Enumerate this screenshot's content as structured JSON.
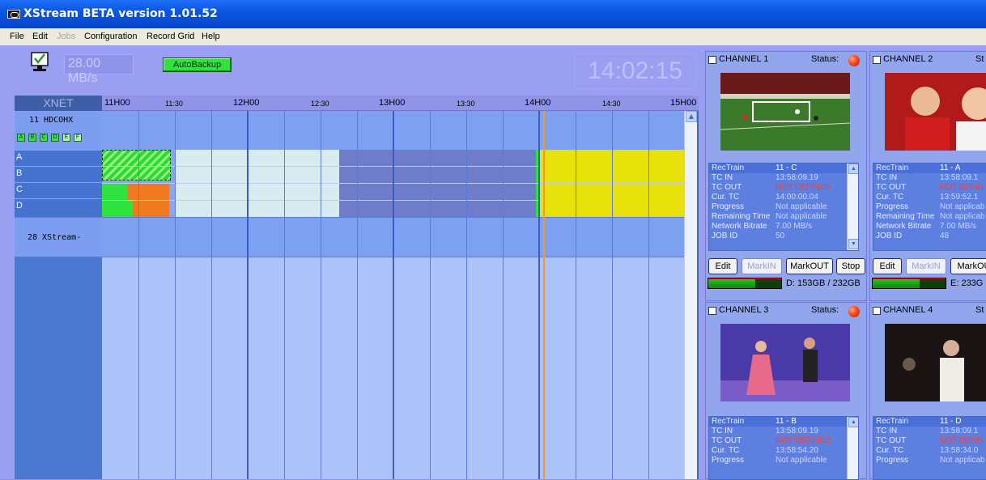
{
  "window": {
    "title": "XStream  BETA version 1.01.52"
  },
  "menu": {
    "file": "File",
    "edit": "Edit",
    "jobs": "Jobs",
    "configuration": "Configuration",
    "record_grid": "Record Grid",
    "help": "Help"
  },
  "toolbar": {
    "bitrate": "28.00 MB/s",
    "autobackup": "AutoBackup",
    "clock": "14:02:15"
  },
  "timeline": {
    "header_left": "XNET",
    "ticks": [
      "11H00",
      "11:30",
      "12H00",
      "12:30",
      "13H00",
      "13:30",
      "14H00",
      "14:30",
      "15H00"
    ],
    "device_name": "11 HDCOHX",
    "channel_boxes": [
      "A",
      "B",
      "C",
      "D",
      "E",
      "F"
    ],
    "rows": [
      "A",
      "B",
      "C",
      "D"
    ],
    "xstream_label": "28 XStream-"
  },
  "channels": [
    {
      "name": "CHANNEL 1",
      "status_label": "Status:",
      "info": {
        "rectrain_label": "RecTrain",
        "rectrain": "11 - C",
        "tc_in_label": "TC IN",
        "tc_in": "13:58:09.19",
        "tc_out_label": "TC OUT",
        "tc_out": "NOT DEFINED",
        "cur_tc_label": "Cur. TC",
        "cur_tc": "14:00:00.04",
        "progress_label": "Progress",
        "progress": "Not applicable",
        "remaining_label": "Remaining Time",
        "remaining": "Not applicable",
        "bitrate_label": "Network Bitrate",
        "bitrate": "7.00 MB/s",
        "job_label": "JOB ID",
        "job": "50"
      },
      "buttons": {
        "edit": "Edit",
        "markin": "MarkIN",
        "markout": "MarkOUT",
        "stop": "Stop"
      },
      "disk": "D: 153GB / 232GB"
    },
    {
      "name": "CHANNEL 2",
      "status_label": "St",
      "info": {
        "rectrain_label": "RecTrain",
        "rectrain": "11 - A",
        "tc_in_label": "TC IN",
        "tc_in": "13:58:09.1",
        "tc_out_label": "TC OUT",
        "tc_out": "NOT DEFIN",
        "cur_tc_label": "Cur. TC",
        "cur_tc": "13:59:52.1",
        "progress_label": "Progress",
        "progress": "Not applicab",
        "remaining_label": "Remaining Time",
        "remaining": "Not applicab",
        "bitrate_label": "Network Bitrate",
        "bitrate": "7.00 MB/s",
        "job_label": "JOB ID",
        "job": "48"
      },
      "buttons": {
        "edit": "Edit",
        "markin": "MarkIN",
        "markout": "MarkOU"
      },
      "disk": "E: 233G"
    },
    {
      "name": "CHANNEL 3",
      "status_label": "Status:",
      "info": {
        "rectrain_label": "RecTrain",
        "rectrain": "11 - B",
        "tc_in_label": "TC IN",
        "tc_in": "13:58:09.19",
        "tc_out_label": "TC OUT",
        "tc_out": "NOT DEFINED",
        "cur_tc_label": "Cur. TC",
        "cur_tc": "13:58:54.20",
        "progress_label": "Progress",
        "progress": "Not applicable"
      }
    },
    {
      "name": "CHANNEL 4",
      "status_label": "St",
      "info": {
        "rectrain_label": "RecTrain",
        "rectrain": "11 - D",
        "tc_in_label": "TC IN",
        "tc_in": "13:58:09.1",
        "tc_out_label": "TC OUT",
        "tc_out": "NOT DEFIN",
        "cur_tc_label": "Cur. TC",
        "cur_tc": "13:58:34.0",
        "progress_label": "Progress",
        "progress": "Not applicab"
      }
    }
  ],
  "colors": {
    "titlebar": "#0a56e3",
    "workarea": "#9b9ff1",
    "recording_green": "#2fe33f",
    "recording_orange": "#f07a1f",
    "scheduled_yellow": "#e6e20a",
    "playhead": "#f39a2a",
    "status_red": "#ff4d1c"
  }
}
